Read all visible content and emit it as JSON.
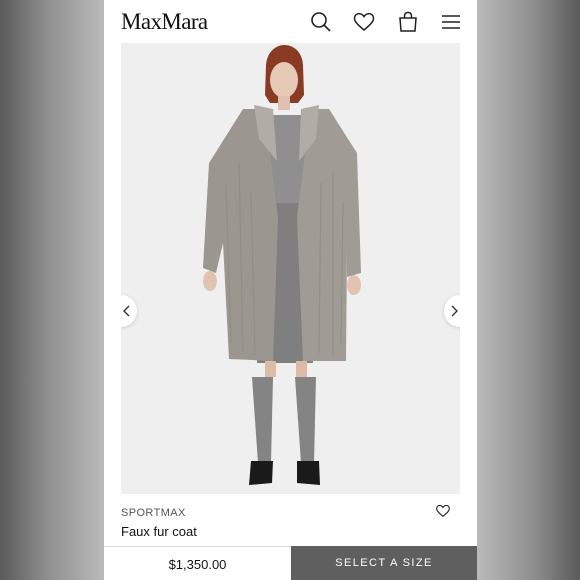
{
  "header": {
    "logo": "MaxMara",
    "icons": [
      "search-icon",
      "heart-icon",
      "shopping-bag-icon",
      "menu-icon"
    ]
  },
  "product": {
    "brand": "SPORTMAX",
    "name": "Faux fur coat",
    "price": "$1,350.00",
    "select_size_label": "SELECT A SIZE"
  },
  "colors": {
    "select_button_bg": "#5f5f5f",
    "coat": "#9c9690",
    "background": "#efefef"
  }
}
